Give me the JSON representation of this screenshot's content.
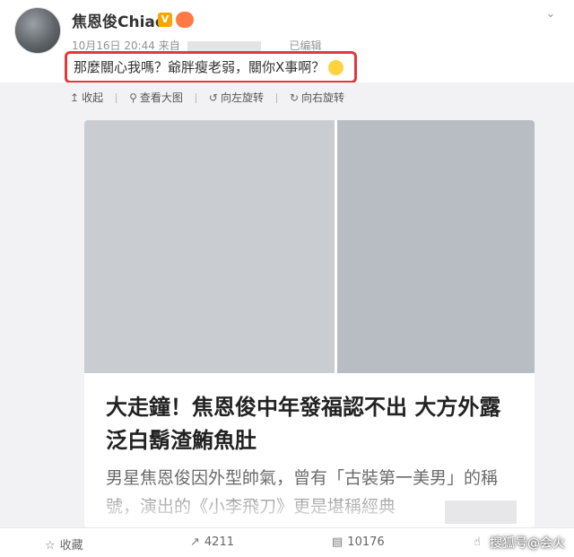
{
  "post": {
    "username": "焦恩俊Chiao",
    "verified_badge": "V",
    "date": "10月16日 20:44",
    "source_prefix": "来自",
    "edited": "已编辑",
    "text": "那麼關心我嗎？爺胖瘦老弱，關你X事啊？"
  },
  "toolbar": {
    "collapse": "收起",
    "view_large": "查看大图",
    "rotate_left": "向左旋转",
    "rotate_right": "向右旋转"
  },
  "card": {
    "headline": "大走鐘！焦恩俊中年發福認不出 大方外露泛白鬍渣鮪魚肚",
    "summary": "男星焦恩俊因外型帥氣，曾有「古裝第一美男」的稱號，演出的《小李飛刀》更是堪稱經典"
  },
  "actions": {
    "favorite": "收藏",
    "share_count": "4211",
    "comment_count": "10176"
  },
  "watermark": "搜狐号@会火",
  "icons": {
    "menu": "chevron-down-icon",
    "collapse": "collapse-icon",
    "zoom": "magnifier-icon",
    "rotate_left": "rotate-left-icon",
    "rotate_right": "rotate-right-icon",
    "favorite": "star-icon",
    "share": "share-icon",
    "comment": "comment-icon",
    "like": "thumb-up-icon"
  },
  "colors": {
    "highlight_box": "#e03a3a",
    "verified_badge": "#f7a600",
    "background_gray": "#f2f2f5"
  }
}
